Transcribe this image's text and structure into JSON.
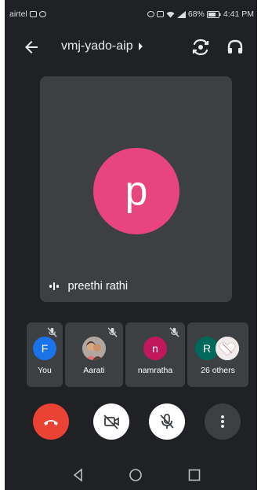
{
  "status_bar": {
    "carrier": "airtel",
    "battery": "68%",
    "time": "4:41 PM"
  },
  "header": {
    "meeting_code": "vmj-yado-aip",
    "back_icon": "arrow-left-icon",
    "switch_camera_icon": "camera-switch-icon",
    "audio_icon": "headphones-icon"
  },
  "main_tile": {
    "avatar_letter": "p",
    "speaker_name": "preethi rathi",
    "avatar_color": "#e8457e"
  },
  "participants": [
    {
      "initial": "F",
      "name": "You",
      "color": "#1a73e8"
    },
    {
      "initial": "",
      "name": "Aarati",
      "color": "#8d6e63"
    },
    {
      "initial": "n",
      "name": "namratha",
      "color": "#c2185b"
    },
    {
      "initial": "R",
      "name": "26 others",
      "color": "#00695c"
    }
  ],
  "controls": {
    "end_call_color": "#ea4335",
    "buttons": [
      "end-call",
      "camera-off",
      "mic-off",
      "more-options"
    ]
  },
  "nav": [
    "back",
    "home",
    "recents"
  ]
}
